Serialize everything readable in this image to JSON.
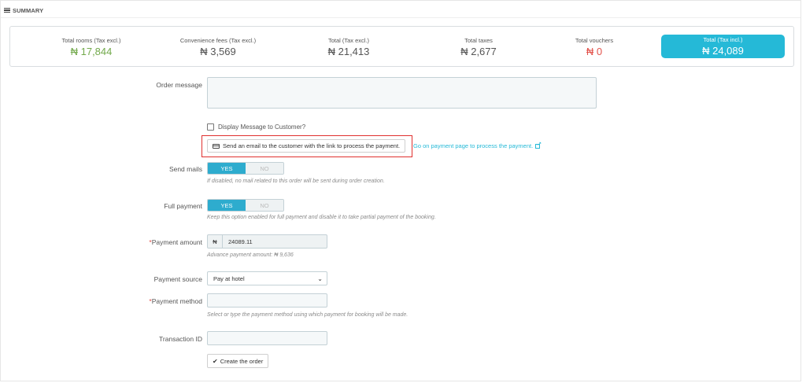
{
  "header": {
    "title": "SUMMARY"
  },
  "totals": [
    {
      "label": "Total rooms (Tax excl.)",
      "value": "₦ 17,844",
      "tone": "green"
    },
    {
      "label": "Convenience fees (Tax excl.)",
      "value": "₦ 3,569",
      "tone": "default"
    },
    {
      "label": "Total (Tax excl.)",
      "value": "₦ 21,413",
      "tone": "default"
    },
    {
      "label": "Total taxes",
      "value": "₦ 2,677",
      "tone": "default"
    },
    {
      "label": "Total vouchers",
      "value": "₦ 0",
      "tone": "red"
    },
    {
      "label": "Total (Tax incl.)",
      "value": "₦ 24,089",
      "tone": "highlight"
    }
  ],
  "form": {
    "order_message": {
      "label": "Order message",
      "value": ""
    },
    "display_message": {
      "label": "Display Message to Customer?",
      "checked": false
    },
    "send_email_button": "Send an email to the customer with the link to process the payment.",
    "payment_page_link": "Go on payment page to process the payment.",
    "send_mails": {
      "label": "Send mails",
      "yes": "YES",
      "no": "NO",
      "selected": "YES",
      "help": "If disabled, no mail related to this order will be sent during order creation."
    },
    "full_payment": {
      "label": "Full payment",
      "yes": "YES",
      "no": "NO",
      "selected": "YES",
      "help": "Keep this option enabled for full payment and disable it to take partial payment of the booking."
    },
    "payment_amount": {
      "label": "Payment amount",
      "required_mark": "*",
      "currency": "₦",
      "value": "24089.11",
      "help": "Advance payment amount: ₦ 9,636"
    },
    "payment_source": {
      "label": "Payment source",
      "selected": "Pay at hotel"
    },
    "payment_method": {
      "label": "Payment method",
      "required_mark": "*",
      "value": "",
      "help": "Select or type the payment method using which payment for booking will be made."
    },
    "transaction_id": {
      "label": "Transaction ID",
      "value": ""
    },
    "create_button": "Create the order"
  },
  "colors": {
    "accent": "#25b9d7",
    "green": "#72a94b",
    "red": "#e2524b",
    "highlight_frame": "#e0302e"
  }
}
